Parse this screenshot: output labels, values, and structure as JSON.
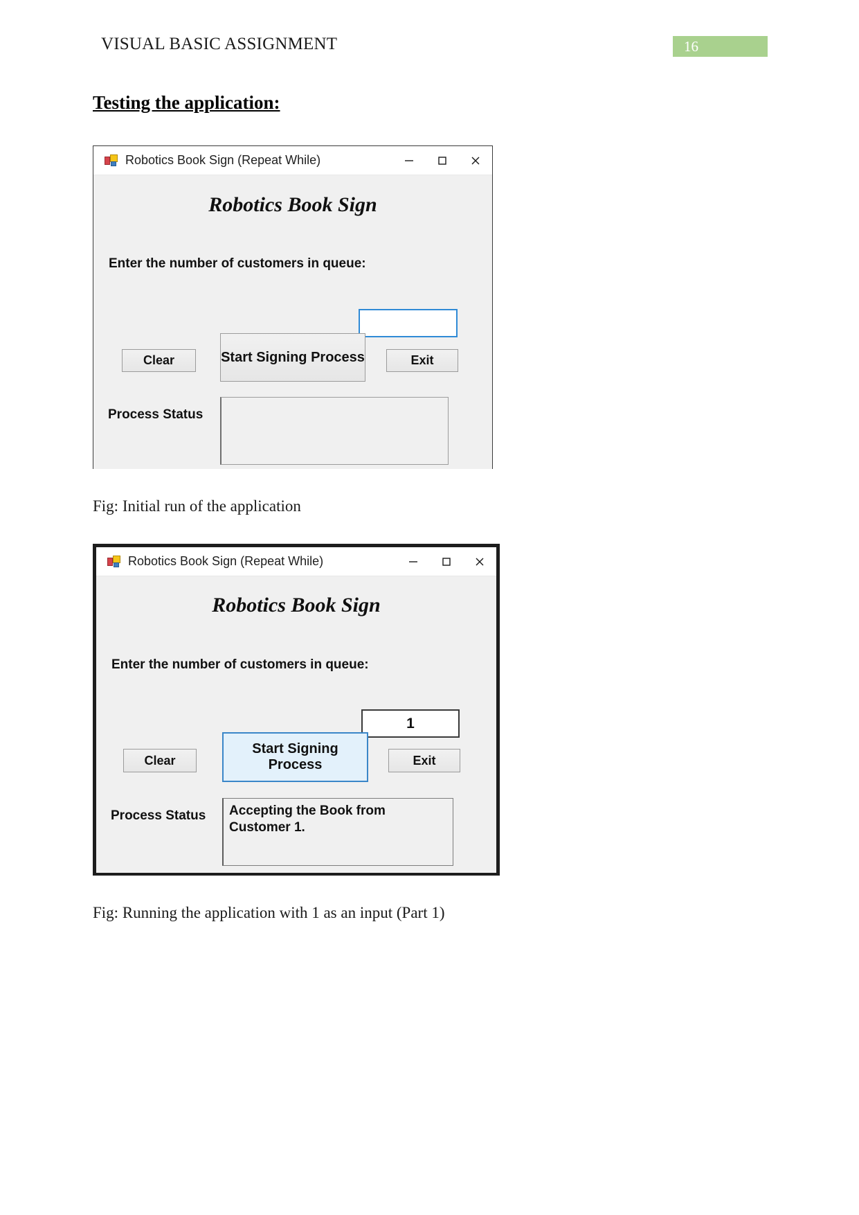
{
  "document": {
    "header_title": "VISUAL BASIC ASSIGNMENT",
    "page_number": "16",
    "page_badge_color": "#a9d18e",
    "section_heading": "Testing the application:",
    "caption_1": "Fig: Initial run of the application",
    "caption_2": "Fig: Running the application with 1 as an input (Part 1)"
  },
  "window_1": {
    "titlebar": {
      "icon": "vb-form-icon",
      "title": "Robotics Book Sign (Repeat While)",
      "minimize_label": "—",
      "maximize_label": "□",
      "close_label": "✕"
    },
    "form": {
      "heading": "Robotics Book Sign",
      "prompt_label": "Enter the number of customers in queue:",
      "queue_input_value": "",
      "queue_input_placeholder": "",
      "clear_button": "Clear",
      "start_button": "Start Signing\nProcess",
      "exit_button": "Exit",
      "status_label": "Process Status",
      "status_text": "",
      "input_border_color": "#2f8ad6",
      "start_button_focused": false
    }
  },
  "window_2": {
    "titlebar": {
      "icon": "vb-form-icon",
      "title": "Robotics Book Sign (Repeat While)",
      "minimize_label": "—",
      "maximize_label": "□",
      "close_label": "✕"
    },
    "form": {
      "heading": "Robotics Book Sign",
      "prompt_label": "Enter the number of customers in queue:",
      "queue_input_value": "1",
      "queue_input_placeholder": "",
      "clear_button": "Clear",
      "start_button": "Start Signing\nProcess",
      "exit_button": "Exit",
      "status_label": "Process Status",
      "status_text": "Accepting the Book from Customer 1.",
      "input_border_color": "#3a3a3a",
      "start_button_focused": true,
      "focus_border_color": "#3a86c8",
      "focus_fill_color": "#e3f1fb"
    }
  }
}
